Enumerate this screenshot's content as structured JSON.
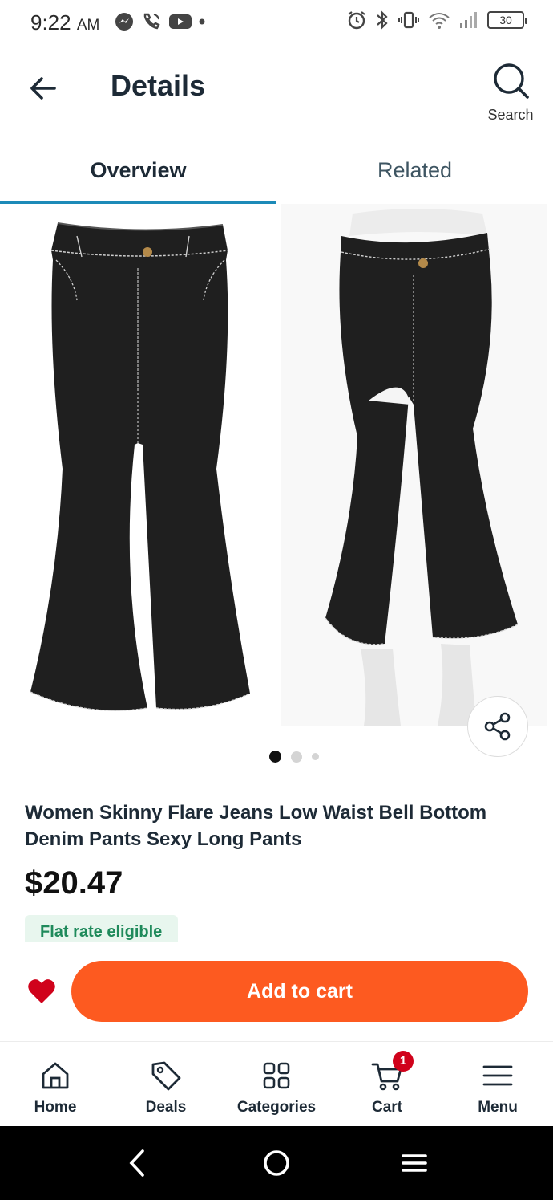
{
  "status_bar": {
    "time": "9:22",
    "ampm": "AM",
    "battery": "30"
  },
  "header": {
    "title": "Details",
    "search_label": "Search"
  },
  "tabs": [
    {
      "label": "Overview",
      "active": true
    },
    {
      "label": "Related",
      "active": false
    }
  ],
  "gallery": {
    "image_count": 3,
    "active_index": 0
  },
  "product": {
    "title": "Women Skinny Flare Jeans Low Waist Bell Bottom Denim Pants Sexy Long Pants",
    "price": "$20.47",
    "badge": "Flat rate eligible"
  },
  "actions": {
    "add_to_cart_label": "Add to cart",
    "favorite_color": "#d0021b",
    "button_color": "#fd5a20"
  },
  "bottom_nav": {
    "items": [
      {
        "label": "Home",
        "icon": "home-icon"
      },
      {
        "label": "Deals",
        "icon": "tag-icon"
      },
      {
        "label": "Categories",
        "icon": "grid-icon"
      },
      {
        "label": "Cart",
        "icon": "cart-icon",
        "badge": "1"
      },
      {
        "label": "Menu",
        "icon": "menu-icon"
      }
    ]
  },
  "colors": {
    "tab_indicator": "#1c8ab8",
    "badge_bg": "#e8f6ee",
    "badge_text": "#1f8a5b"
  }
}
